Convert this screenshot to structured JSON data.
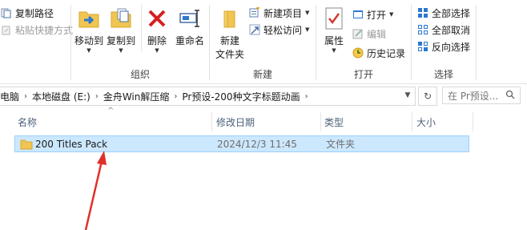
{
  "ribbon": {
    "clipboard": {
      "copy_path": "复制路径",
      "paste_shortcut": "粘贴快捷方式"
    },
    "organize": {
      "label": "组织",
      "move_to": "移动到",
      "copy_to": "复制到",
      "delete": "删除",
      "rename": "重命名"
    },
    "new": {
      "label": "新建",
      "new_folder_line1": "新建",
      "new_folder_line2": "文件夹",
      "new_item": "新建项目",
      "easy_access": "轻松访问"
    },
    "open": {
      "label": "打开",
      "properties": "属性",
      "open": "打开",
      "edit": "编辑",
      "history": "历史记录"
    },
    "select": {
      "label": "选择",
      "select_all": "全部选择",
      "select_none": "全部取消",
      "invert": "反向选择"
    }
  },
  "address": {
    "crumbs": [
      "电脑",
      "本地磁盘 (E:)",
      "金舟Win解压缩",
      "Pr预设-200种文字标题动画"
    ],
    "search_placeholder": "在 Pr预设..."
  },
  "columns": {
    "name": "名称",
    "modified": "修改日期",
    "type": "类型",
    "size": "大小"
  },
  "files": [
    {
      "name": "200 Titles Pack",
      "modified": "2024/12/3 11:45",
      "type": "文件夹",
      "size": ""
    }
  ],
  "colors": {
    "selection_bg": "#cce8ff",
    "selection_border": "#99d1ff",
    "annotation_arrow": "#e0302a"
  }
}
